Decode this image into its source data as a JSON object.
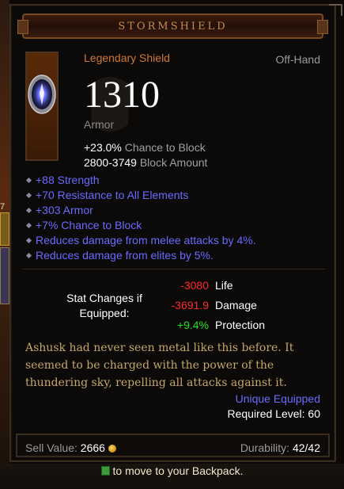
{
  "title": "STORMSHIELD",
  "item_type": "Legendary Shield",
  "slot": "Off-Hand",
  "armor_value": "1310",
  "armor_label": "Armor",
  "base_stats": [
    {
      "value": "+23.0%",
      "label": "Chance to Block"
    },
    {
      "value": "2800-3749",
      "label": "Block Amount"
    }
  ],
  "affixes": [
    "+88 Strength",
    "+70 Resistance to All Elements",
    "+303 Armor",
    "+7% Chance to Block",
    "Reduces damage from melee attacks by 4%.",
    "Reduces damage from elites by 5%."
  ],
  "stat_changes": {
    "label": "Stat Changes if Equipped:",
    "rows": [
      {
        "value": "-3080",
        "name": "Life",
        "color": "#ff2a2a"
      },
      {
        "value": "-3691.9",
        "name": "Damage",
        "color": "#ff2a2a"
      },
      {
        "value": "+9.4%",
        "name": "Protection",
        "color": "#20e020"
      }
    ]
  },
  "flavor_text": "Ashusk had never seen metal like this before. It seemed to be charged with the power of the thundering sky, repelling all attacks against it.",
  "unique_equipped": "Unique Equipped",
  "required_level": "Required Level: 60",
  "sell_value_label": "Sell Value:",
  "sell_value": "2666",
  "durability_label": "Durability:",
  "durability": "42/42",
  "background": {
    "left_mark": "7",
    "hint_text": "to move to your Backpack."
  },
  "icons": [
    "shield-item-icon",
    "gold-coin-icon",
    "key-hint-icon"
  ],
  "colors": {
    "legendary": "#d07838",
    "magic": "#6a6aff",
    "negative": "#ff2a2a",
    "positive": "#20e020",
    "flavor": "#c6a66a"
  }
}
